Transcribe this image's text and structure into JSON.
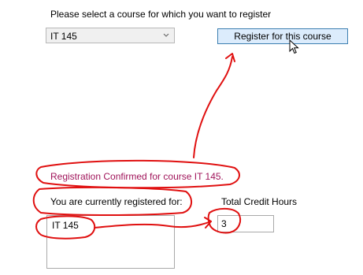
{
  "form": {
    "course_prompt": "Please select a course for which you want to register",
    "selected_course": "IT 145",
    "register_button": "Register for this course",
    "confirmation": "Registration Confirmed for course IT 145.",
    "registered_label": "You are currently registered for:",
    "credit_label": "Total Credit Hours",
    "registered_items": [
      "IT 145"
    ],
    "total_credit_hours": "3"
  },
  "colors": {
    "confirmation_text": "#a0145a",
    "annotation_ink": "#e01010",
    "button_fill": "#dcecfc",
    "button_border": "#3c7fb1"
  },
  "icons": {
    "dropdown": "chevron-down-icon",
    "cursor": "mouse-pointer-icon"
  }
}
